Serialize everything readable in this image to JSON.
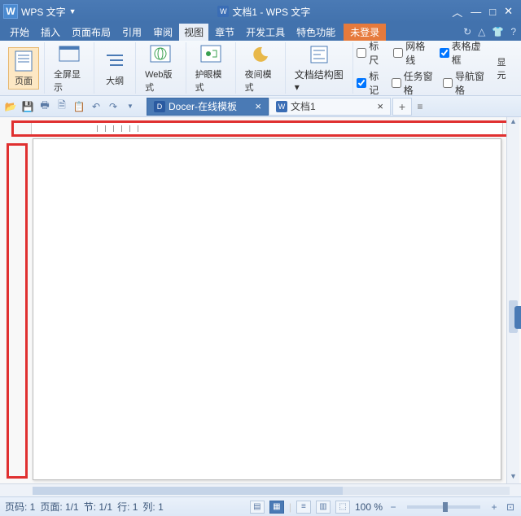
{
  "titlebar": {
    "app_name": "WPS 文字",
    "doc_title": "文档1 - WPS 文字"
  },
  "menubar": {
    "items": [
      "开始",
      "插入",
      "页面布局",
      "引用",
      "审阅",
      "视图",
      "章节",
      "开发工具",
      "特色功能"
    ],
    "active_index": 5,
    "login": "未登录"
  },
  "ribbon": {
    "btns": [
      {
        "label": "页面"
      },
      {
        "label": "全屏显示"
      },
      {
        "label": "大纲"
      },
      {
        "label": "Web版式"
      },
      {
        "label": "护眼模式"
      },
      {
        "label": "夜间模式"
      },
      {
        "label": "文档结构图"
      }
    ],
    "checks_row1": [
      {
        "label": "标尺",
        "checked": false
      },
      {
        "label": "网格线",
        "checked": false
      },
      {
        "label": "表格虚框",
        "checked": true
      }
    ],
    "checks_row2": [
      {
        "label": "标记",
        "checked": true
      },
      {
        "label": "任务窗格",
        "checked": false
      },
      {
        "label": "导航窗格",
        "checked": false
      }
    ],
    "overflow": "显元"
  },
  "tabs": [
    {
      "label": "Docer-在线模板",
      "icon": "D",
      "active": true
    },
    {
      "label": "文档1",
      "icon": "W",
      "active": false
    }
  ],
  "status": {
    "page_code": "页码: 1",
    "page": "页面: 1/1",
    "section": "节: 1/1",
    "line": "行: 1",
    "col": "列: 1",
    "zoom": "100 %"
  }
}
